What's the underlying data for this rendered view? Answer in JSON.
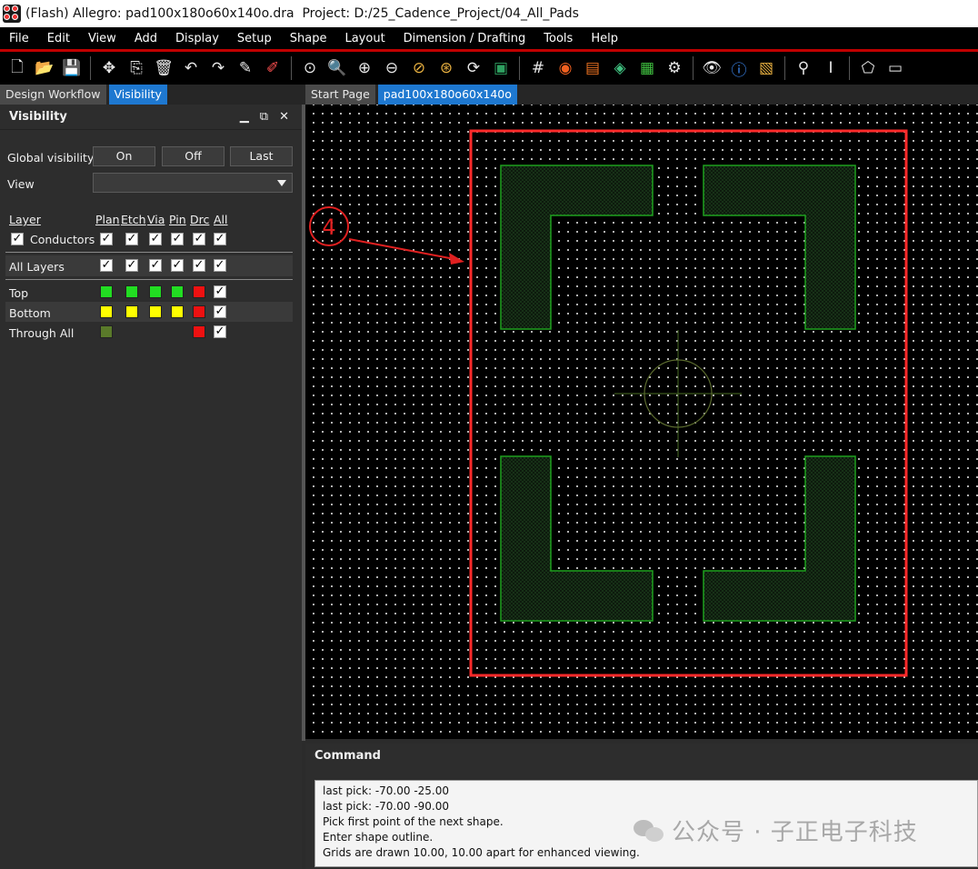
{
  "window": {
    "title": "(Flash) Allegro: pad100x180o60x140o.dra  Project: D:/25_Cadence_Project/04_All_Pads"
  },
  "menu": [
    "File",
    "Edit",
    "View",
    "Add",
    "Display",
    "Setup",
    "Shape",
    "Layout",
    "Dimension / Drafting",
    "Tools",
    "Help"
  ],
  "left_tabs": {
    "design_workflow": "Design Workflow",
    "visibility": "Visibility"
  },
  "visibility": {
    "title": "Visibility",
    "global_visibility_label": "Global visibility",
    "on": "On",
    "off": "Off",
    "last": "Last",
    "view_label": "View",
    "view_value": "",
    "columns": {
      "layer": "Layer",
      "plan": "Plan",
      "etch": "Etch",
      "via": "Via",
      "pin": "Pin",
      "drc": "Drc",
      "all": "All"
    },
    "conductors": "Conductors",
    "all_layers": "All Layers",
    "layers": [
      {
        "name": "Top",
        "colors": [
          "#22dd22",
          "#22dd22",
          "#22dd22",
          "#22dd22",
          "#ee1111"
        ]
      },
      {
        "name": "Bottom",
        "colors": [
          "#ffff00",
          "#ffff00",
          "#ffff00",
          "#ffff00",
          "#ee1111"
        ]
      },
      {
        "name": "Through All",
        "colors": [
          "#5a7a2a",
          "",
          "",
          "",
          "#ee1111"
        ]
      }
    ]
  },
  "canvas_tabs": {
    "start_page": "Start Page",
    "design": "pad100x180o60x140o"
  },
  "annotation": {
    "number": "4"
  },
  "colors": {
    "accent_tab": "#1e78d0",
    "shape_outline": "#1ea01e",
    "highlight_box": "#ff2a2a",
    "annotation": "#e02020"
  },
  "command": {
    "title": "Command",
    "lines": [
      "last pick:  -70.00 -25.00",
      "last pick:  -70.00 -90.00",
      "Pick first point of the next shape.",
      "Enter shape outline.",
      "Grids are drawn 10.00, 10.00 apart for enhanced viewing."
    ]
  },
  "watermark": {
    "text": "公众号 · 子正电子科技"
  }
}
